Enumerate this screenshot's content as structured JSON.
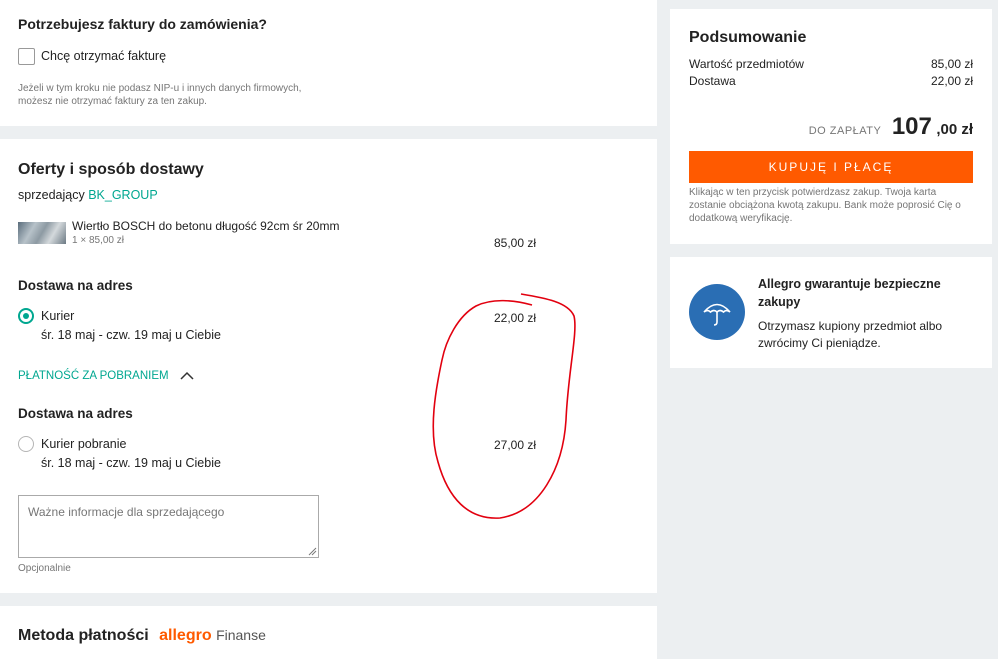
{
  "invoice": {
    "title": "Potrzebujesz faktury do zamówienia?",
    "checkbox_label": "Chcę otrzymać fakturę",
    "note_line1": "Jeżeli w tym kroku nie podasz NIP-u i innych danych firmowych,",
    "note_line2": "możesz nie otrzymać faktury za ten zakup."
  },
  "offers": {
    "title": "Oferty i sposób dostawy",
    "seller_prefix": "sprzedający",
    "seller_name": "BK_GROUP",
    "item_name": "Wiertło BOSCH do betonu długość 92cm śr 20mm",
    "item_qty": "1 × 85,00 zł",
    "item_price": "85,00 zł",
    "delivery1_title": "Dostawa na adres",
    "courier_name": "Kurier",
    "courier_dates": "śr. 18 maj - czw. 19 maj u Ciebie",
    "courier_price": "22,00 zł",
    "cod_toggle": "PŁATNOŚĆ ZA POBRANIEM",
    "delivery2_title": "Dostawa na adres",
    "cod_courier_name": "Kurier pobranie",
    "cod_courier_dates": "śr. 18 maj - czw. 19 maj u Ciebie",
    "cod_courier_price": "27,00 zł",
    "seller_note_placeholder": "Ważne informacje dla sprzedającego",
    "optional_label": "Opcjonalnie"
  },
  "payment": {
    "title": "Metoda płatności",
    "brand": "allegro",
    "brand_suffix": "Finanse"
  },
  "summary": {
    "title": "Podsumowanie",
    "items_label": "Wartość przedmiotów",
    "items_value": "85,00 zł",
    "delivery_label": "Dostawa",
    "delivery_value": "22,00 zł",
    "to_pay_label": "DO ZAPŁATY",
    "to_pay_main": "107",
    "to_pay_cents": ",00 zł",
    "buy_button": "KUPUJĘ I PŁACĘ",
    "disclaimer_line1": "Klikając w ten przycisk potwierdzasz zakup. Twoja karta",
    "disclaimer_line2": "zostanie obciążona kwotą zakupu. Bank może poprosić Cię o",
    "disclaimer_line3": "dodatkową weryfikację."
  },
  "guarantee": {
    "title_line1": "Allegro gwarantuje bezpieczne",
    "title_line2": "zakupy",
    "text_line1": "Otrzymasz kupiony przedmiot albo",
    "text_line2": "zwrócimy Ci pieniądze."
  },
  "icons": {
    "guarantee": "umbrella-icon",
    "collapse": "chevron-up-icon"
  },
  "colors": {
    "accent_teal": "#00a790",
    "buy_orange": "#ff5a00",
    "brand_orange": "#ff5a00",
    "umbrella_blue": "#2a6eb4",
    "annotation_red": "#e2000f"
  }
}
